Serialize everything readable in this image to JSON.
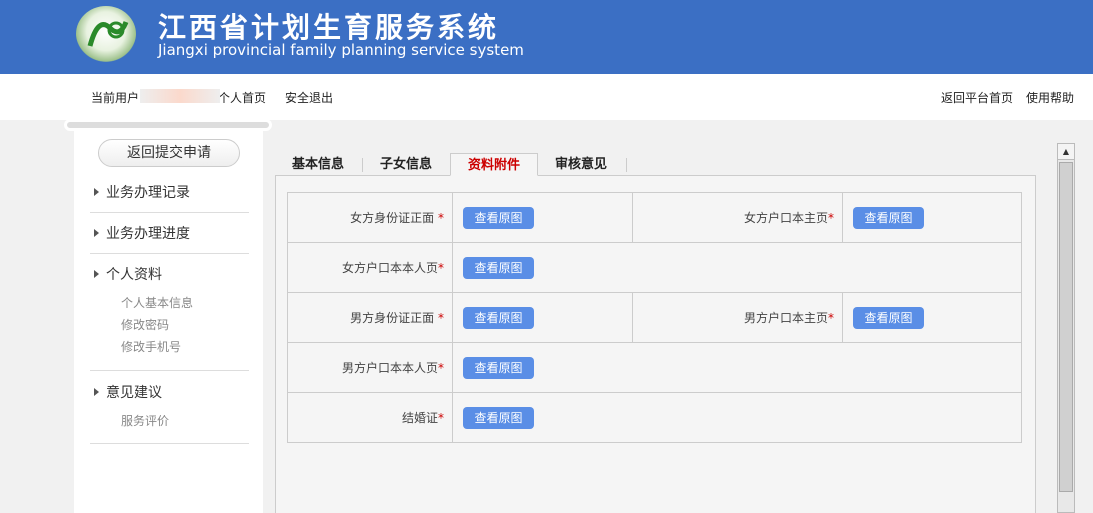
{
  "header": {
    "title": "江西省计划生育服务系统",
    "subtitle": "Jiangxi provincial family planning service system"
  },
  "topbar": {
    "current_user": "当前用户",
    "home": "个人首页",
    "logout": "安全退出",
    "platform": "返回平台首页",
    "help": "使用帮助"
  },
  "sidebar": {
    "back": "返回提交申请",
    "menus": [
      "业务办理记录",
      "业务办理进度",
      "个人资料",
      "意见建议"
    ],
    "personal_sub": [
      "个人基本信息",
      "修改密码",
      "修改手机号"
    ],
    "feedback_sub": [
      "服务评价"
    ]
  },
  "tabs": [
    "基本信息",
    "子女信息",
    "资料附件",
    "审核意见"
  ],
  "attachments": {
    "button": "查看原图",
    "star": "*",
    "labels": [
      "女方身份证正面",
      "女方户口本主页",
      "女方户口本本人页",
      "男方身份证正面",
      "男方户口本主页",
      "男方户口本本人页",
      "结婚证"
    ]
  }
}
